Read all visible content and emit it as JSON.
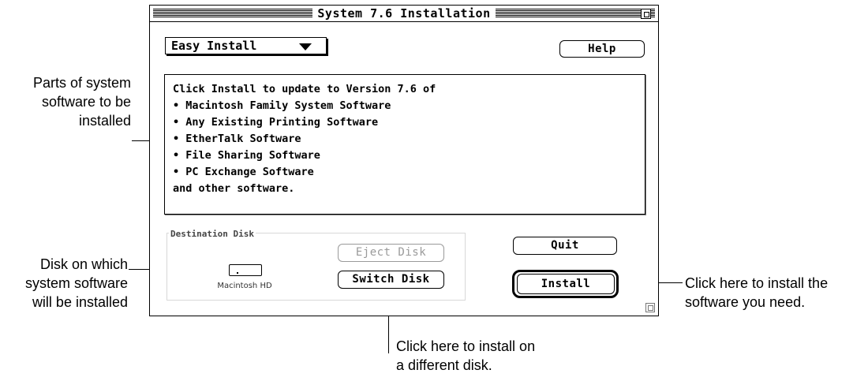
{
  "window": {
    "title": "System 7.6 Installation",
    "popup_label": "Easy Install",
    "help_label": "Help",
    "text_lines": [
      "Click Install to update to Version 7.6 of",
      "• Macintosh Family System Software",
      "• Any Existing Printing Software",
      "• EtherTalk Software",
      "• File Sharing Software",
      "• PC Exchange Software",
      "and other software."
    ],
    "destination_title": "Destination Disk",
    "disk_name": "Macintosh HD",
    "eject_label": "Eject Disk",
    "switch_label": "Switch Disk",
    "quit_label": "Quit",
    "install_label": "Install"
  },
  "annotations": {
    "parts": [
      "Parts of system",
      "software to be",
      "installed"
    ],
    "disk": [
      "Disk on which",
      "system software",
      "will be installed"
    ],
    "install": [
      "Click here to install the",
      "software you need."
    ],
    "switch": [
      "Click here to install on",
      "a different disk."
    ]
  }
}
